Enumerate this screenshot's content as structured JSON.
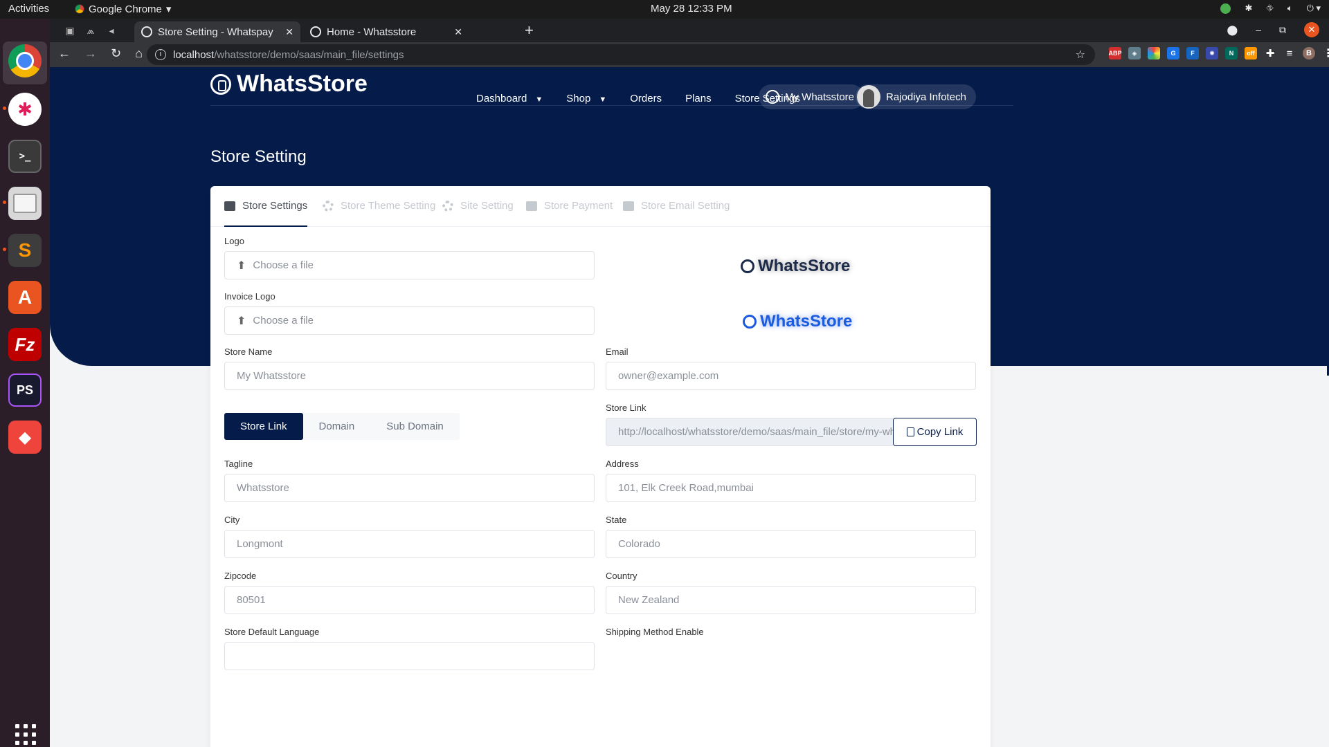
{
  "os": {
    "activities": "Activities",
    "app_name": "Google Chrome",
    "clock": "May 28  12:33 PM"
  },
  "browser": {
    "tabs": [
      {
        "title": "Store Setting - Whatspay",
        "active": true
      },
      {
        "title": "Home - Whatsstore",
        "active": false
      }
    ],
    "url_host": "localhost",
    "url_path": "/whatsstore/demo/saas/main_file/settings",
    "profile_initial": "B"
  },
  "site": {
    "brand": "WhatsStore",
    "nav": {
      "dashboard": "Dashboard",
      "shop": "Shop",
      "orders": "Orders",
      "plans": "Plans",
      "store_settings": "Store Settings"
    },
    "my_store_button": "My Whatsstore",
    "user_name": "Rajodiya Infotech"
  },
  "page": {
    "title": "Store Setting",
    "tabs": [
      {
        "label": "Store Settings",
        "active": true
      },
      {
        "label": "Store Theme Setting",
        "active": false
      },
      {
        "label": "Site Setting",
        "active": false
      },
      {
        "label": "Store Payment",
        "active": false
      },
      {
        "label": "Store Email Setting",
        "active": false
      }
    ]
  },
  "form": {
    "logo_label": "Logo",
    "logo_placeholder": "Choose a file",
    "logo_preview": "WhatsStore",
    "invoice_logo_label": "Invoice Logo",
    "invoice_logo_placeholder": "Choose a file",
    "invoice_logo_preview": "WhatsStore",
    "store_name_label": "Store Name",
    "store_name_value": "My Whatsstore",
    "email_label": "Email",
    "email_value": "owner@example.com",
    "link_types": [
      "Store Link",
      "Domain",
      "Sub Domain"
    ],
    "link_type_selected": "Store Link",
    "store_link_label": "Store Link",
    "store_link_value": "http://localhost/whatsstore/demo/saas/main_file/store/my-whatss",
    "copy_link": "Copy Link",
    "tagline_label": "Tagline",
    "tagline_value": "Whatsstore",
    "address_label": "Address",
    "address_value": "101, Elk Creek Road,mumbai",
    "city_label": "City",
    "city_value": "Longmont",
    "state_label": "State",
    "state_value": "Colorado",
    "zipcode_label": "Zipcode",
    "zipcode_value": "80501",
    "country_label": "Country",
    "country_value": "New Zealand",
    "default_language_label": "Store Default Language",
    "shipping_label": "Shipping Method Enable"
  },
  "colors": {
    "primary": "#051c4b",
    "brand_blue": "#1a5be0",
    "ubuntu_orange": "#e95420"
  }
}
